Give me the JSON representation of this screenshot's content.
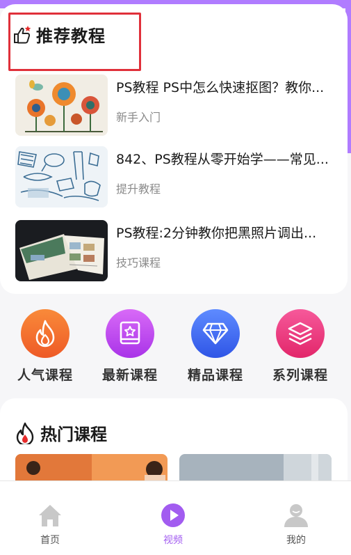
{
  "colors": {
    "accent": "#b07cff",
    "active_tab": "#a25cf0",
    "highlight": "#e0303a"
  },
  "recommended": {
    "title": "推荐教程",
    "icon": "thumbs-up-icon",
    "courses": [
      {
        "title": "PS教程 PS中怎么快速抠图？教你...",
        "tag": "新手入门",
        "thumb": "flowers-illustration"
      },
      {
        "title": "842、PS教程从零开始学——常见...",
        "tag": "提升教程",
        "thumb": "sketch-drawings"
      },
      {
        "title": "PS教程:2分钟教你把黑照片调出...",
        "tag": "技巧课程",
        "thumb": "brochure-photo"
      }
    ]
  },
  "categories": [
    {
      "label": "人气课程",
      "icon": "flame-icon",
      "color": "#f06a2a"
    },
    {
      "label": "最新课程",
      "icon": "new-book-icon",
      "color": "#c04cf0"
    },
    {
      "label": "精品课程",
      "icon": "diamond-icon",
      "color": "#3d6ef0"
    },
    {
      "label": "系列课程",
      "icon": "layers-icon",
      "color": "#ee3d7d"
    }
  ],
  "hot": {
    "title": "热门课程",
    "icon": "flame-outline-icon"
  },
  "tabs": [
    {
      "label": "首页",
      "icon": "home-icon"
    },
    {
      "label": "视频",
      "icon": "play-icon",
      "active": true
    },
    {
      "label": "我的",
      "icon": "profile-icon"
    }
  ]
}
